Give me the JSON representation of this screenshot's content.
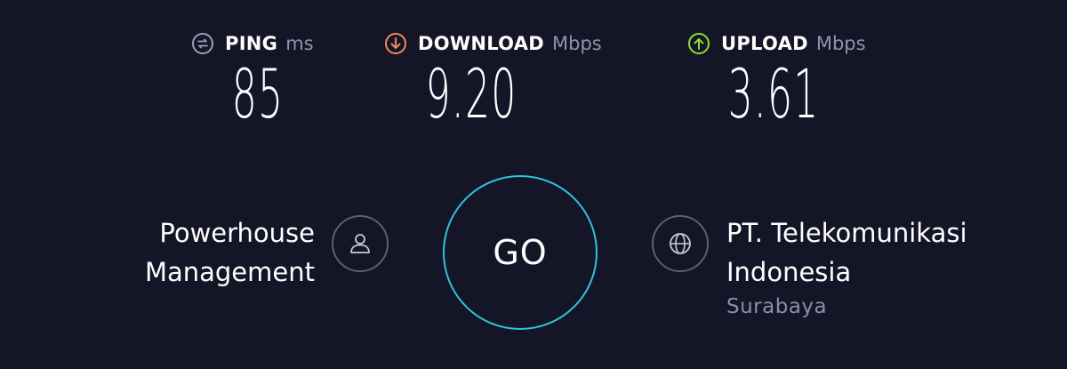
{
  "metrics": {
    "ping": {
      "label": "PING",
      "unit": "ms",
      "value": "85",
      "icon": "ping-icon",
      "color": "#9ea0b3"
    },
    "download": {
      "label": "DOWNLOAD",
      "unit": "Mbps",
      "value": "9.20",
      "icon": "download-icon",
      "color": "#f2885f"
    },
    "upload": {
      "label": "UPLOAD",
      "unit": "Mbps",
      "value": "3.61",
      "icon": "upload-icon",
      "color": "#8be132"
    }
  },
  "provider": {
    "line1": "Powerhouse",
    "line2": "Management",
    "icon": "user-icon"
  },
  "go_button": {
    "label": "GO",
    "ring_color": "#2fc3dd"
  },
  "server": {
    "line1": "PT. Telekomunikasi",
    "line2": "Indonesia",
    "location": "Surabaya",
    "icon": "globe-icon"
  },
  "colors": {
    "background": "#141526",
    "muted_text": "#8d8fa5"
  }
}
